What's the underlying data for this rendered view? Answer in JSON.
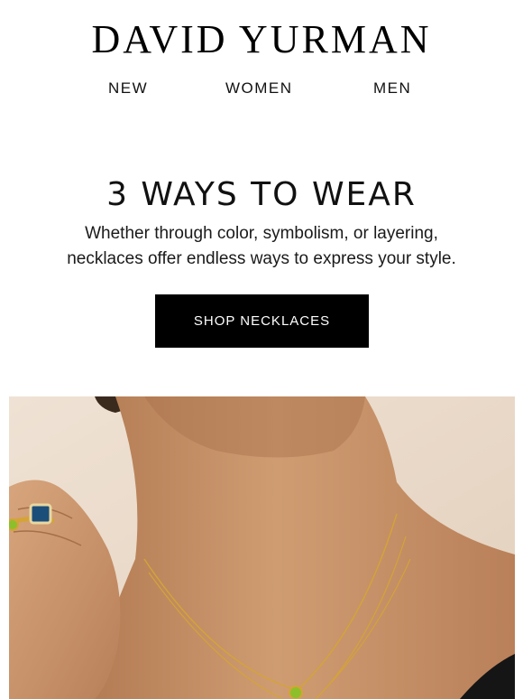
{
  "brand": {
    "logo_text": "DAVID YURMAN"
  },
  "nav": {
    "items": [
      {
        "label": "NEW"
      },
      {
        "label": "WOMEN"
      },
      {
        "label": "MEN"
      }
    ]
  },
  "promo": {
    "headline": "3 WAYS TO WEAR",
    "subcopy_line1": "Whether through color, symbolism, or layering,",
    "subcopy_line2": "necklaces offer endless ways to express your style.",
    "cta_label": "SHOP NECKLACES"
  },
  "hero": {
    "background_color": "#e9d9c8",
    "skin_color": "#c9956b",
    "gold_color": "#d4a437",
    "gemstone_blue": "#1c4e7a",
    "gemstone_green": "#8dbf2a"
  }
}
